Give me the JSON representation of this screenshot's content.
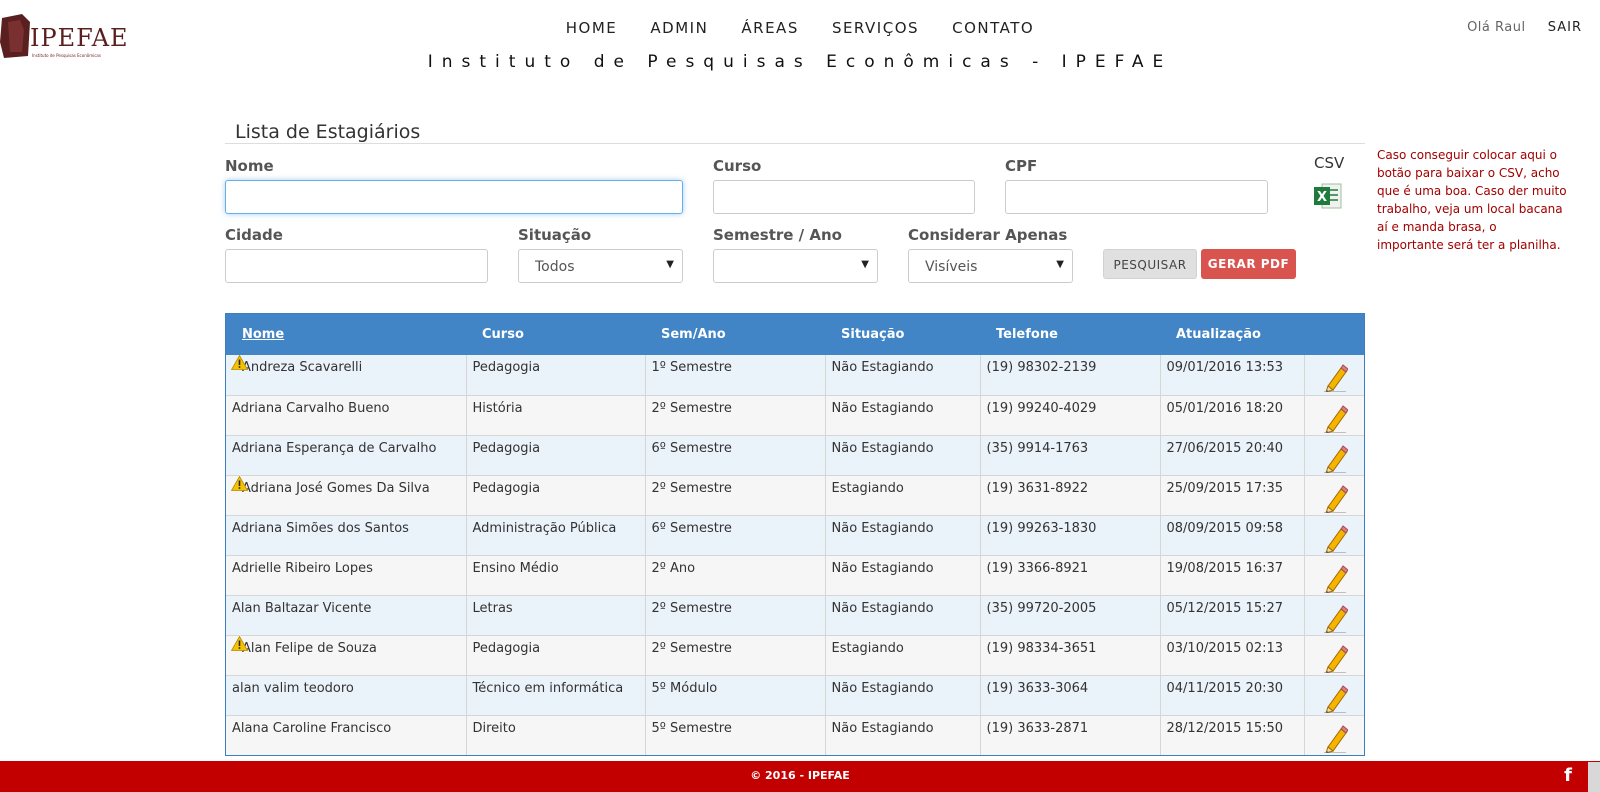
{
  "brand": {
    "logo_text": "IPEFAE",
    "logo_sub": "Instituto de Pesquisas Econômicas",
    "brand_color": "#5a1f1f"
  },
  "nav": {
    "items": [
      "HOME",
      "ADMIN",
      "ÁREAS",
      "SERVIÇOS",
      "CONTATO"
    ]
  },
  "subtitle": "Instituto de Pesquisas Econômicas - IPEFAE",
  "user": {
    "greeting": "Olá Raul",
    "logout": "SAIR"
  },
  "page_title": "Lista de Estagiários",
  "filters": {
    "nome": {
      "label": "Nome",
      "value": ""
    },
    "curso": {
      "label": "Curso",
      "value": ""
    },
    "cpf": {
      "label": "CPF",
      "value": ""
    },
    "csv": {
      "label": "CSV",
      "icon": "excel-icon"
    },
    "cidade": {
      "label": "Cidade",
      "value": ""
    },
    "situacao": {
      "label": "Situação",
      "selected": "Todos"
    },
    "semestre": {
      "label": "Semestre / Ano",
      "selected": ""
    },
    "considerar": {
      "label": "Considerar Apenas",
      "selected": "Visíveis"
    }
  },
  "buttons": {
    "search": "PESQUISAR",
    "pdf": "GERAR PDF",
    "pdf_color": "#d9534f"
  },
  "note": "Caso conseguir colocar aqui o botão para baixar o CSV, acho que é uma boa. Caso der muito trabalho, veja um local bacana aí e manda brasa, o importante será ter a planilha.",
  "table": {
    "header_color": "#4185c7",
    "columns": [
      "Nome",
      "Curso",
      "Sem/Ano",
      "Situação",
      "Telefone",
      "Atualização",
      ""
    ],
    "rows": [
      {
        "warn": true,
        "cells": [
          "Andreza Scavarelli",
          "Pedagogia",
          "1º Semestre",
          "Não Estagiando",
          "(19) 98302-2139",
          "09/01/2016 13:53"
        ]
      },
      {
        "warn": false,
        "cells": [
          "Adriana Carvalho Bueno",
          "História",
          "2º Semestre",
          "Não Estagiando",
          "(19) 99240-4029",
          "05/01/2016 18:20"
        ]
      },
      {
        "warn": false,
        "cells": [
          "Adriana Esperança de Carvalho",
          "Pedagogia",
          "6º Semestre",
          "Não Estagiando",
          "(35) 9914-1763",
          "27/06/2015 20:40"
        ]
      },
      {
        "warn": true,
        "cells": [
          "Adriana José Gomes Da Silva",
          "Pedagogia",
          "2º Semestre",
          "Estagiando",
          "(19) 3631-8922",
          "25/09/2015 17:35"
        ]
      },
      {
        "warn": false,
        "cells": [
          "Adriana Simões dos Santos",
          "Administração Pública",
          "6º Semestre",
          "Não Estagiando",
          "(19) 99263-1830",
          "08/09/2015 09:58"
        ]
      },
      {
        "warn": false,
        "cells": [
          "Adrielle Ribeiro Lopes",
          "Ensino Médio",
          "2º Ano",
          "Não Estagiando",
          "(19) 3366-8921",
          "19/08/2015 16:37"
        ]
      },
      {
        "warn": false,
        "cells": [
          "Alan Baltazar Vicente",
          "Letras",
          "2º Semestre",
          "Não Estagiando",
          "(35) 99720-2005",
          "05/12/2015 15:27"
        ]
      },
      {
        "warn": true,
        "cells": [
          "Alan Felipe de Souza",
          "Pedagogia",
          "2º Semestre",
          "Estagiando",
          "(19) 98334-3651",
          "03/10/2015 02:13"
        ]
      },
      {
        "warn": false,
        "cells": [
          "alan valim teodoro",
          "Técnico em informática",
          "5º Módulo",
          "Não Estagiando",
          "(19) 3633-3064",
          "04/11/2015 20:30"
        ]
      },
      {
        "warn": false,
        "cells": [
          "Alana Caroline Francisco",
          "Direito",
          "5º Semestre",
          "Não Estagiando",
          "(19) 3633-2871",
          "28/12/2015 15:50"
        ]
      }
    ]
  },
  "footer": {
    "text": "© 2016 - IPEFAE",
    "social": "f",
    "color": "#c30000"
  }
}
